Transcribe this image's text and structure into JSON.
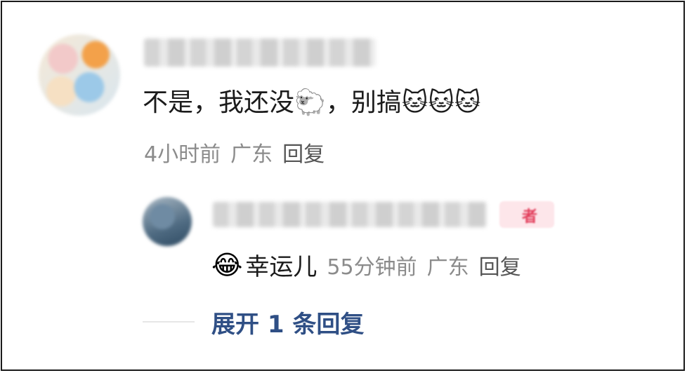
{
  "comment": {
    "text": "不是，我还没🐑，别搞🐱🐱🐱",
    "time": "4小时前",
    "location": "广东",
    "reply_label": "回复"
  },
  "reply": {
    "author_badge": "者",
    "emoji": "😂",
    "text": "幸运儿",
    "time": "55分钟前",
    "location": "广东",
    "reply_label": "回复"
  },
  "expand_label": "展开 1 条回复"
}
